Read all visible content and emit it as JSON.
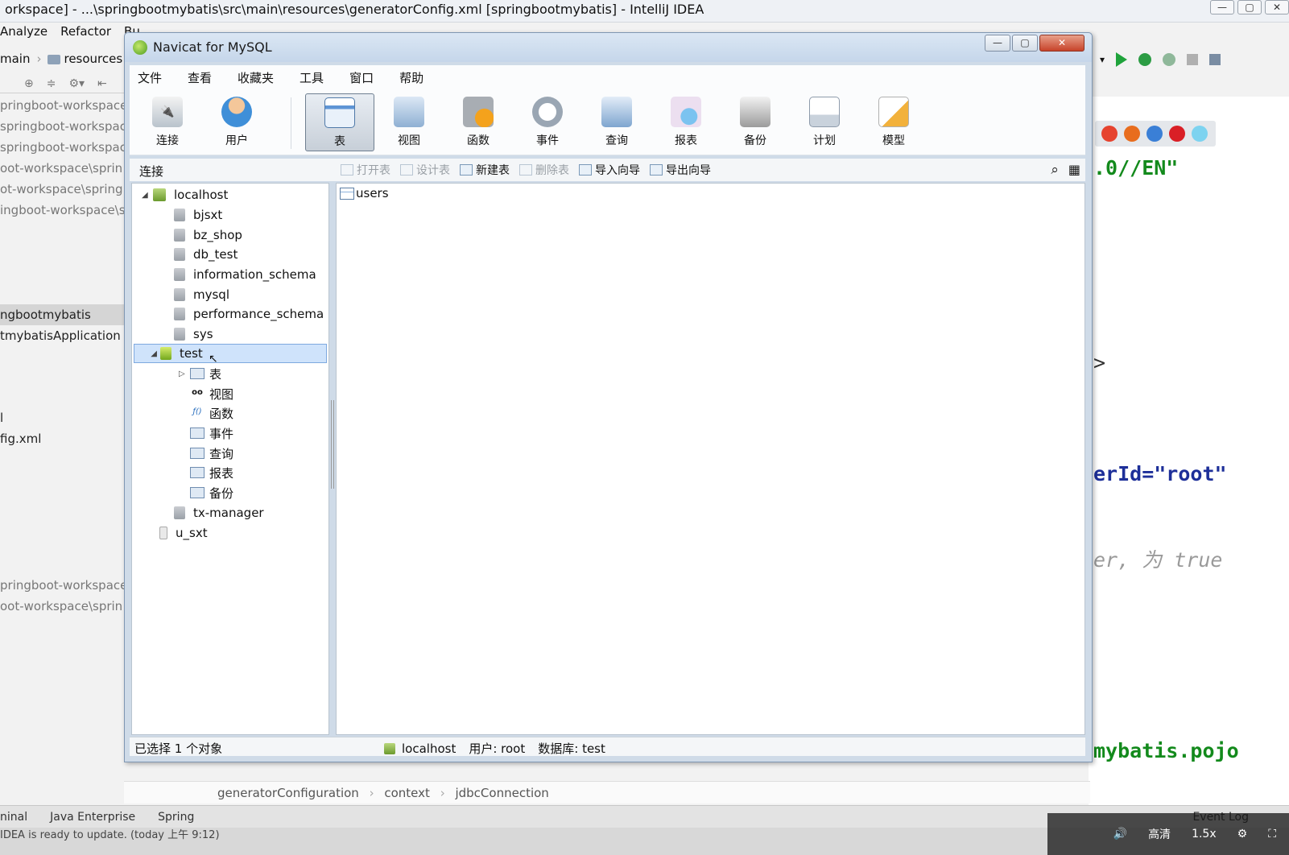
{
  "ide": {
    "title": "orkspace] - ...\\springbootmybatis\\src\\main\\resources\\generatorConfig.xml [springbootmybatis] - IntelliJ IDEA",
    "menu": [
      "Analyze",
      "Refactor",
      "Bu"
    ],
    "crumbs": [
      "main",
      "resources"
    ],
    "project_rows": [
      "pringboot-workspace",
      "springboot-workspac",
      "springboot-workspac",
      "oot-workspace\\sprin",
      "ot-workspace\\spring",
      "ingboot-workspace\\s",
      "ngbootmybatis",
      "tmybatisApplication",
      "l",
      "fig.xml",
      "pringboot-workspace",
      "oot-workspace\\sprin"
    ],
    "editor_lines": [
      ".0//EN\"",
      ">",
      "erId=\"root\"",
      "er, 为 true",
      "mybatis.pojo"
    ],
    "bottom_crumbs": [
      "generatorConfiguration",
      "context",
      "jdbcConnection"
    ],
    "tool_tabs": [
      "ninal",
      "Java Enterprise",
      "Spring"
    ],
    "event_log": "Event Log",
    "status_text": "IDEA is ready to update. (today 上午 9:12)",
    "video": {
      "quality": "高清",
      "speed": "1.5x"
    }
  },
  "navicat": {
    "title": "Navicat for MySQL",
    "menu": [
      "文件",
      "查看",
      "收藏夹",
      "工具",
      "窗口",
      "帮助"
    ],
    "toolbar": [
      "连接",
      "用户",
      "表",
      "视图",
      "函数",
      "事件",
      "查询",
      "报表",
      "备份",
      "计划",
      "模型"
    ],
    "objbar": {
      "label": "连接",
      "buttons": [
        "打开表",
        "设计表",
        "新建表",
        "删除表",
        "导入向导",
        "导出向导"
      ]
    },
    "tree": {
      "connection": "localhost",
      "databases": [
        "bjsxt",
        "bz_shop",
        "db_test",
        "information_schema",
        "mysql",
        "performance_schema",
        "sys",
        "test"
      ],
      "test_children": [
        "表",
        "视图",
        "函数",
        "事件",
        "查询",
        "报表",
        "备份"
      ],
      "after": [
        "tx-manager"
      ],
      "other_connection": "u_sxt"
    },
    "tables": [
      "users"
    ],
    "status": {
      "selection": "已选择 1 个对象",
      "connection": "localhost",
      "user": "用户: root",
      "database": "数据库: test"
    }
  }
}
